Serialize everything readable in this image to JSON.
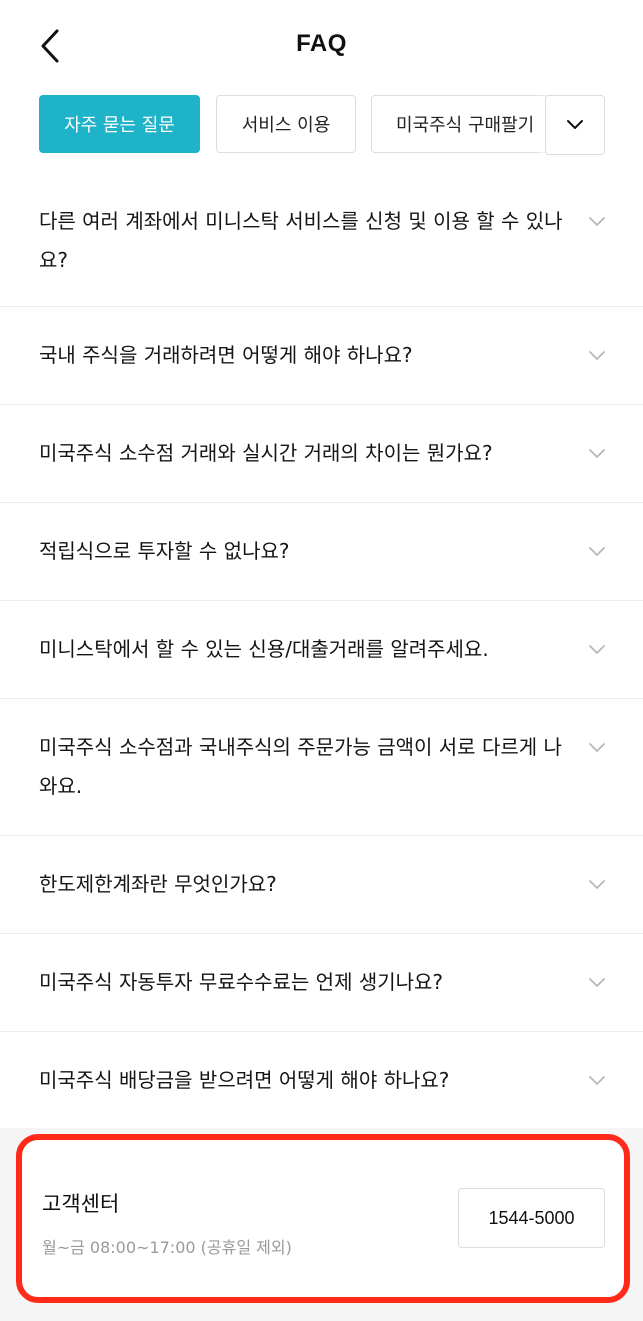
{
  "header": {
    "title": "FAQ",
    "back_icon": "chevron-left-icon"
  },
  "tabs": [
    {
      "label": "자주 묻는 질문",
      "active": true
    },
    {
      "label": "서비스 이용",
      "active": false
    },
    {
      "label": "미국주식 구매팔기",
      "active": false
    }
  ],
  "more_icon": "chevron-down-icon",
  "faq": [
    {
      "question": "다른 여러 계좌에서 미니스탁 서비스를 신청 및 이용 할 수 있나요?"
    },
    {
      "question": "국내 주식을 거래하려면 어떻게 해야 하나요?"
    },
    {
      "question": "미국주식 소수점 거래와 실시간 거래의 차이는 뭔가요?"
    },
    {
      "question": "적립식으로 투자할 수 없나요?"
    },
    {
      "question": "미니스탁에서 할 수 있는 신용/대출거래를 알려주세요."
    },
    {
      "question": "미국주식 소수점과 국내주식의 주문가능 금액이 서로 다르게 나와요."
    },
    {
      "question": "한도제한계좌란 무엇인가요?"
    },
    {
      "question": "미국주식 자동투자 무료수수료는 언제 생기나요?"
    },
    {
      "question": "미국주식 배당금을 받으려면 어떻게 해야 하나요?"
    }
  ],
  "footer": {
    "title": "고객센터",
    "hours": "월~금 08:00~17:00 (공휴일 제외)",
    "phone": "1544-5000"
  },
  "colors": {
    "accent": "#1fb3c9",
    "highlight_border": "#ff2a1a",
    "muted_text": "#9a9a9a",
    "divider": "#eeeeee"
  }
}
